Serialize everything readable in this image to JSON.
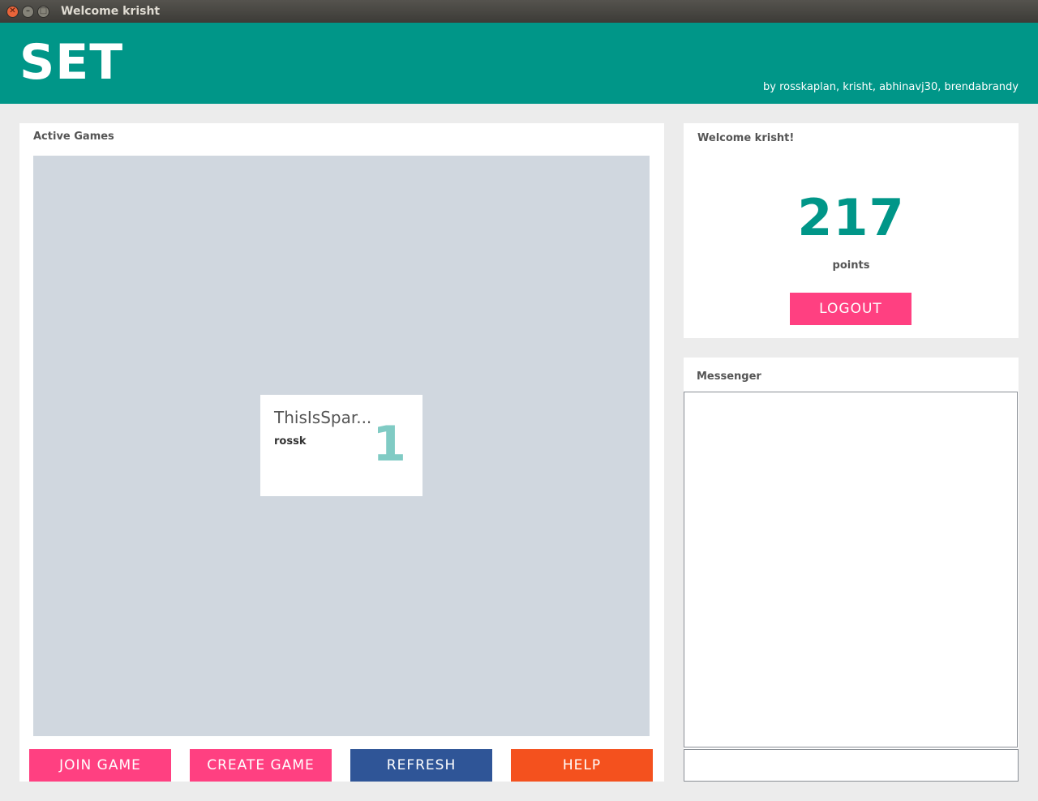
{
  "window": {
    "title": "Welcome krisht"
  },
  "header": {
    "logo": "SET",
    "credits": "by rosskaplan, krisht, abhinavj30, brendabrandy"
  },
  "games": {
    "title": "Active Games",
    "cards": [
      {
        "name": "ThisIsSpar...",
        "host": "rossk",
        "players": "1"
      }
    ],
    "buttons": {
      "join": "JOIN GAME",
      "create": "CREATE GAME",
      "refresh": "REFRESH",
      "help": "HELP"
    }
  },
  "welcome": {
    "title": "Welcome krisht!",
    "points": "217",
    "points_label": "points",
    "logout": "LOGOUT"
  },
  "messenger": {
    "title": "Messenger",
    "input_value": ""
  },
  "colors": {
    "teal": "#009688",
    "pink": "#ff4081",
    "blue": "#2f5597",
    "orange": "#f4511e"
  }
}
